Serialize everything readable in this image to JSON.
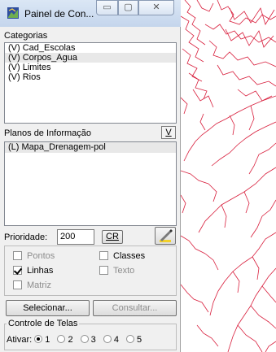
{
  "window": {
    "title": "Painel de Con..."
  },
  "categorias": {
    "label": "Categorias",
    "items": [
      "(V) Cad_Escolas",
      "(V) Corpos_Agua",
      "(V) Limites",
      "(V) Rios"
    ]
  },
  "planos": {
    "label": "Planos de Informação",
    "v_button": "V",
    "items": [
      "(L) Mapa_Drenagem-pol"
    ]
  },
  "prioridade": {
    "label": "Prioridade:",
    "value": "200",
    "cr_button": "CR"
  },
  "options": {
    "pontos": {
      "label": "Pontos",
      "checked": false
    },
    "classes": {
      "label": "Classes",
      "checked": false
    },
    "linhas": {
      "label": "Linhas",
      "checked": true
    },
    "texto": {
      "label": "Texto",
      "checked": false
    },
    "matriz": {
      "label": "Matriz",
      "checked": false
    }
  },
  "actions": {
    "selecionar": "Selecionar...",
    "consultar": "Consultar..."
  },
  "controle": {
    "label": "Controle de Telas",
    "ativar_label": "Ativar:",
    "options": [
      "1",
      "2",
      "3",
      "4",
      "5"
    ],
    "selected": "1"
  },
  "colors": {
    "map_lines": "#d81e3c",
    "titlebar": "#c4d5ec"
  }
}
